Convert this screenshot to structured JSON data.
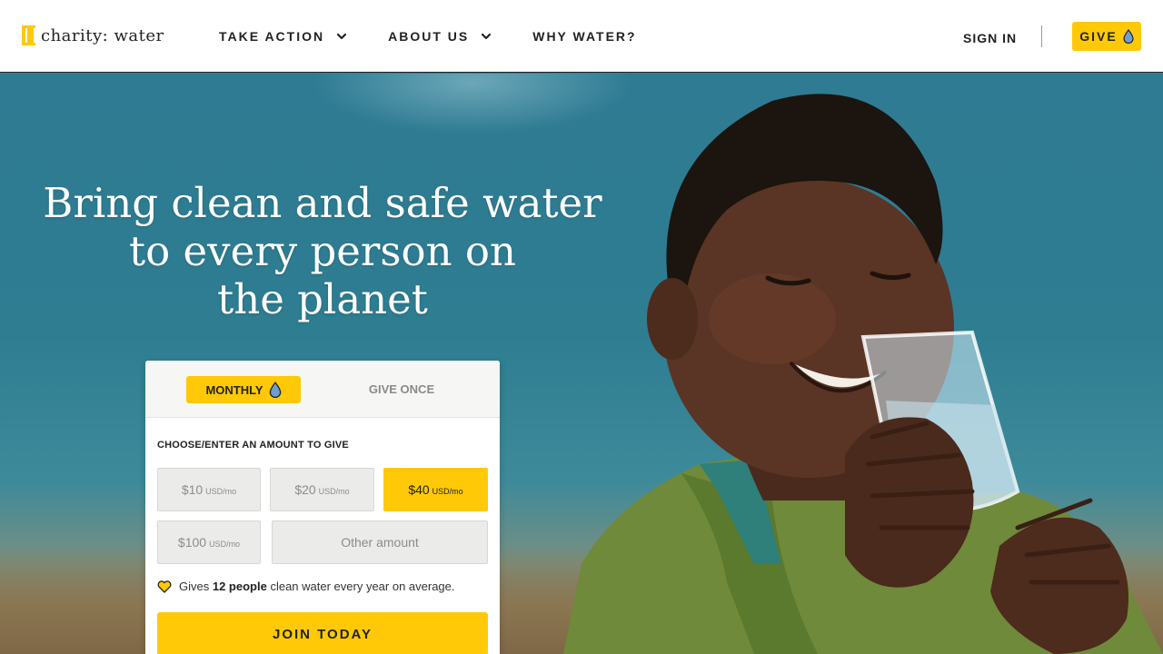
{
  "header": {
    "logo_text": "charity: water",
    "nav": [
      {
        "label": "TAKE ACTION",
        "has_dropdown": true
      },
      {
        "label": "ABOUT US",
        "has_dropdown": true
      },
      {
        "label": "WHY WATER?",
        "has_dropdown": false
      }
    ],
    "sign_in": "SIGN IN",
    "give_label": "GIVE"
  },
  "hero": {
    "title_lines": [
      "Bring clean and safe water",
      "to every person on",
      "the planet"
    ]
  },
  "donation": {
    "tabs": {
      "monthly": "MONTHLY",
      "once": "GIVE ONCE",
      "active": "monthly"
    },
    "choose_label": "CHOOSE/ENTER AN AMOUNT TO GIVE",
    "amounts": [
      {
        "value": "$10",
        "unit": "USD/mo",
        "selected": false
      },
      {
        "value": "$20",
        "unit": "USD/mo",
        "selected": false
      },
      {
        "value": "$40",
        "unit": "USD/mo",
        "selected": true
      },
      {
        "value": "$100",
        "unit": "USD/mo",
        "selected": false
      }
    ],
    "other_amount_placeholder": "Other amount",
    "impact": {
      "prefix": "Gives",
      "count": "12 people",
      "suffix": "clean water every year on average."
    },
    "join_label": "JOIN TODAY"
  },
  "colors": {
    "accent": "#ffc907",
    "sky": "#2f7b93",
    "text": "#222222"
  },
  "icons": [
    "logo-jerrycan-icon",
    "chevron-down-icon",
    "water-drop-icon",
    "heart-icon"
  ]
}
